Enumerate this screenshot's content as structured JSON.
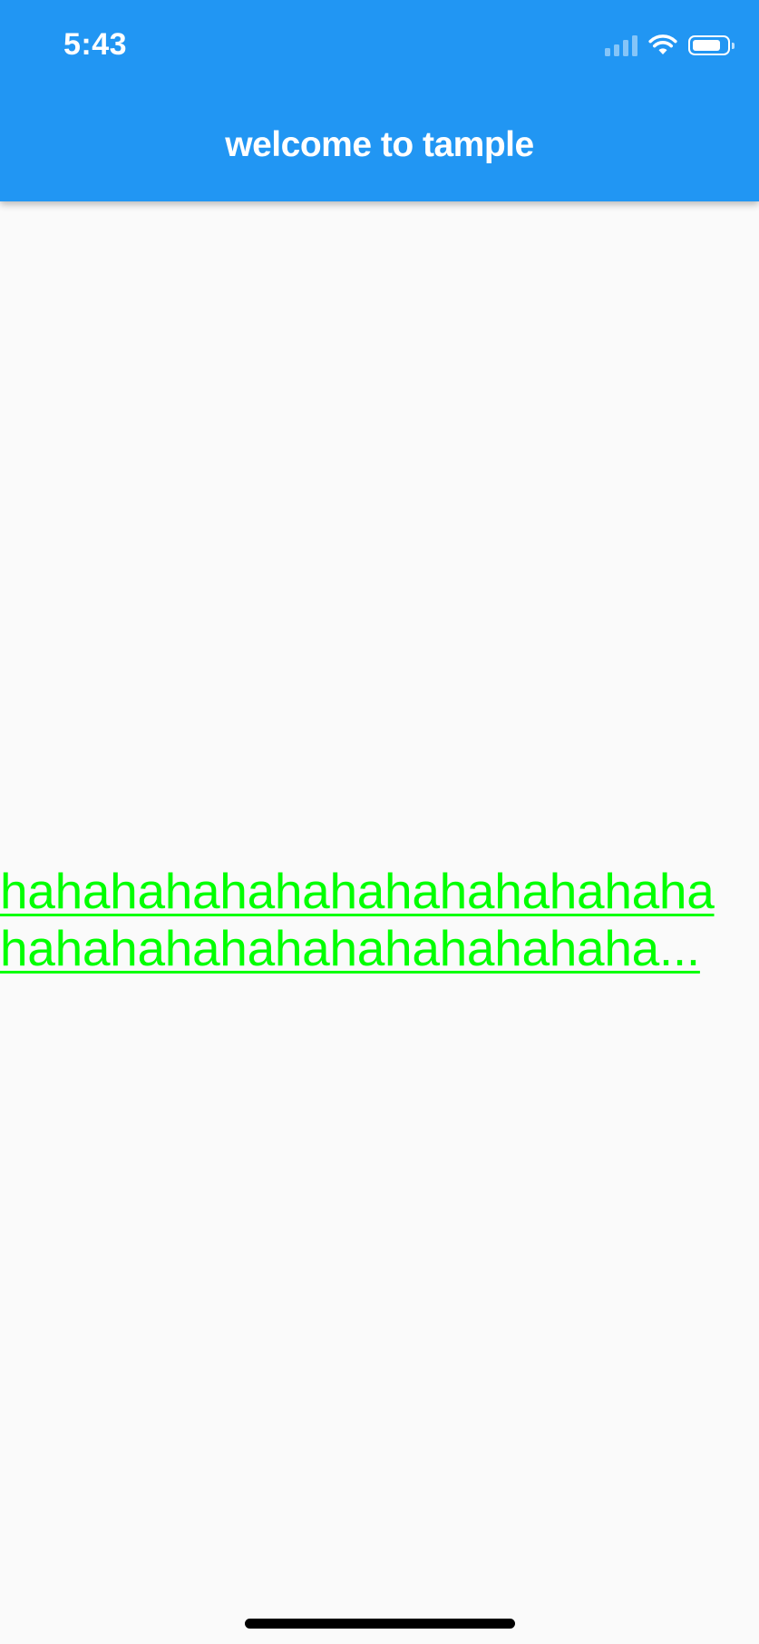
{
  "status_bar": {
    "time": "5:43",
    "icons": [
      "cellular-signal-icon",
      "wifi-icon",
      "battery-icon"
    ],
    "battery_level": 0.85
  },
  "app_bar": {
    "title": "welcome to tample",
    "background": "#2196f3"
  },
  "body": {
    "text_lines": [
      "hahahahahahahahahahahahaha",
      "hahahahahahahahahahahaha..."
    ],
    "text_color": "#00ff00"
  }
}
